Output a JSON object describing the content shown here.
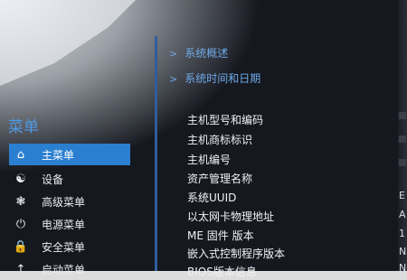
{
  "header_links": [
    {
      "label": "系统概述"
    },
    {
      "label": "系统时间和日期"
    }
  ],
  "sidebar": {
    "title": "菜单",
    "items": [
      {
        "label": "主菜单",
        "icon": "home-icon",
        "selected": true
      },
      {
        "label": "设备",
        "icon": "devices-icon",
        "selected": false
      },
      {
        "label": "高级菜单",
        "icon": "gear-icon",
        "selected": false
      },
      {
        "label": "电源菜单",
        "icon": "power-icon",
        "selected": false
      },
      {
        "label": "安全菜单",
        "icon": "lock-icon",
        "selected": false
      },
      {
        "label": "启动菜单",
        "icon": "boot-icon",
        "selected": false
      }
    ]
  },
  "info": {
    "labels": [
      "主机型号和编码",
      "主机商标标识",
      "主机编号",
      "资产管理名称",
      "系统UUID",
      "以太网卡物理地址",
      "ME 固件 版本",
      "嵌入式控制程序版本",
      "BIOS版本信息"
    ],
    "values_partial": [
      "E",
      "A",
      "1",
      "N",
      "N"
    ]
  },
  "colors": {
    "accent": "#2b7fd0",
    "link": "#6fa8e8",
    "divider": "#2f5d9e",
    "screen_bg": "#15181f"
  }
}
